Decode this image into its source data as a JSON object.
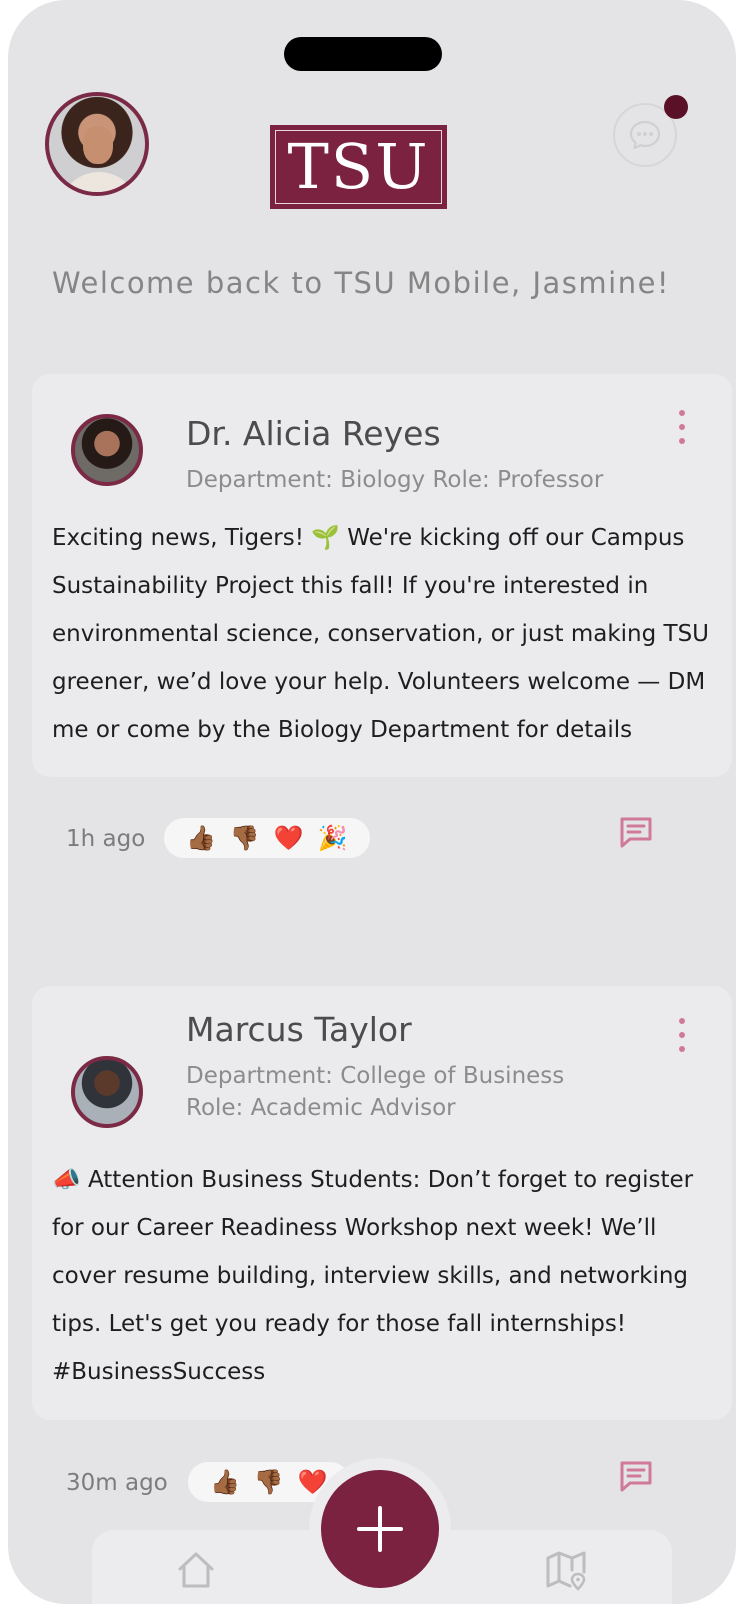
{
  "header": {
    "logo_text": "TSU",
    "welcome": "Welcome back to TSU Mobile, Jasmine!",
    "profile_avatar": "user-avatar",
    "chat_icon": "chat-bubble-icon",
    "has_unread": true
  },
  "posts": [
    {
      "author": "Dr. Alicia Reyes",
      "meta_line1": "Department: Biology Role: Professor",
      "meta_line2": "",
      "body": "Exciting news, Tigers! 🌱 We're kicking off our Campus Sustainability Project this fall! If you're interested in environmental science, conservation, or just making TSU greener, we’d love your help. Volunteers welcome — DM me or come by the Biology Department for details",
      "time": "1h ago",
      "reactions": [
        "👍🏾",
        "👎🏾",
        "❤️",
        "🎉"
      ]
    },
    {
      "author": "Marcus Taylor",
      "meta_line1": "Department: College of Business",
      "meta_line2": "Role: Academic Advisor",
      "body": "📣 Attention Business Students: Don’t forget to register for our Career Readiness Workshop next week! We’ll cover resume building, interview skills, and networking tips. Let's get you ready for those fall internships! #BusinessSuccess",
      "time": "30m ago",
      "reactions": [
        "👍🏾",
        "👎🏾",
        "❤️"
      ]
    }
  ],
  "colors": {
    "brand": "#7b2240",
    "accent_pink": "#d07a98",
    "background": "#e4e4e6",
    "card": "#ebebed"
  },
  "nav": {
    "home_icon": "home-icon",
    "add_icon": "plus-icon",
    "map_icon": "map-pin-icon"
  }
}
